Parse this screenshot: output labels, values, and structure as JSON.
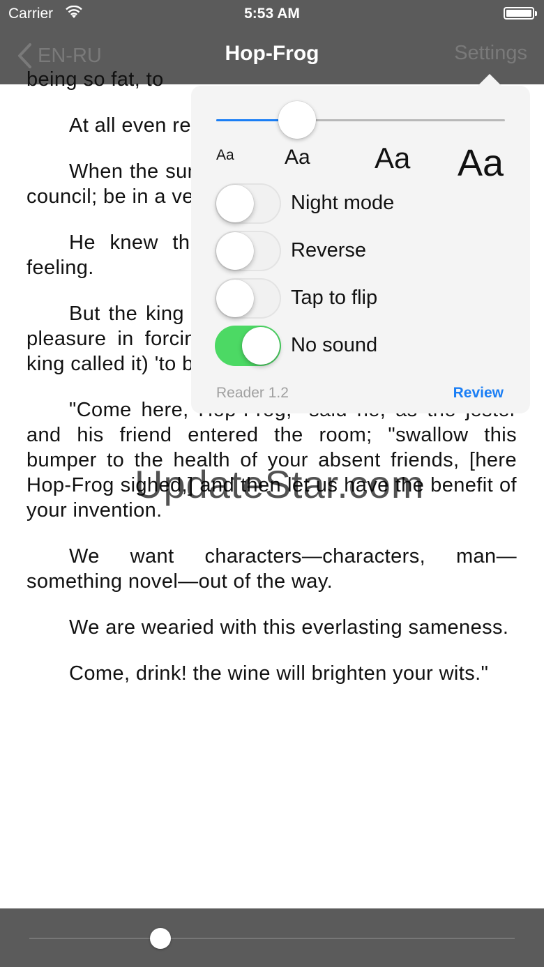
{
  "status_bar": {
    "carrier": "Carrier",
    "time": "5:53 AM"
  },
  "nav": {
    "back_label": "EN-RU",
    "title": "Hop-Frog",
    "settings_label": "Settings"
  },
  "book": {
    "paragraphs": [
      "being so fat, to",
      "At all even resort they sent",
      "When the summons of th at his wine wit cabinet council; be in a very ill h",
      "He knew th wine, for it exc madness; and feeling.",
      "But the king loved his practical jokes, and took pleasure in forcing Hop-Frog to drink and (as the king called it) 'to be merry.'",
      "\"Come here, Hop-Frog,\" said he, as the jester and his friend entered the room; \"swallow this bumper to the health of your absent friends, [here Hop-Frog sighed,] and then let us have the benefit of your invention.",
      "We want characters—characters, man—something novel—out of the way.",
      "We are wearied with this everlasting sameness.",
      "Come, drink! the wine will brighten your wits.\""
    ]
  },
  "watermark": "UpdateStar.com",
  "settings_popover": {
    "font_slider_value": 0.28,
    "font_size_labels": [
      "Aa",
      "Aa",
      "Aa",
      "Aa"
    ],
    "toggles": [
      {
        "label": "Night mode",
        "on": false
      },
      {
        "label": "Reverse",
        "on": false
      },
      {
        "label": "Tap to flip",
        "on": false
      },
      {
        "label": "No sound",
        "on": true
      }
    ],
    "version": "Reader 1.2",
    "review_label": "Review",
    "accent_color": "#1a7ef5",
    "toggle_on_color": "#4cd964"
  },
  "page_progress": 0.27
}
